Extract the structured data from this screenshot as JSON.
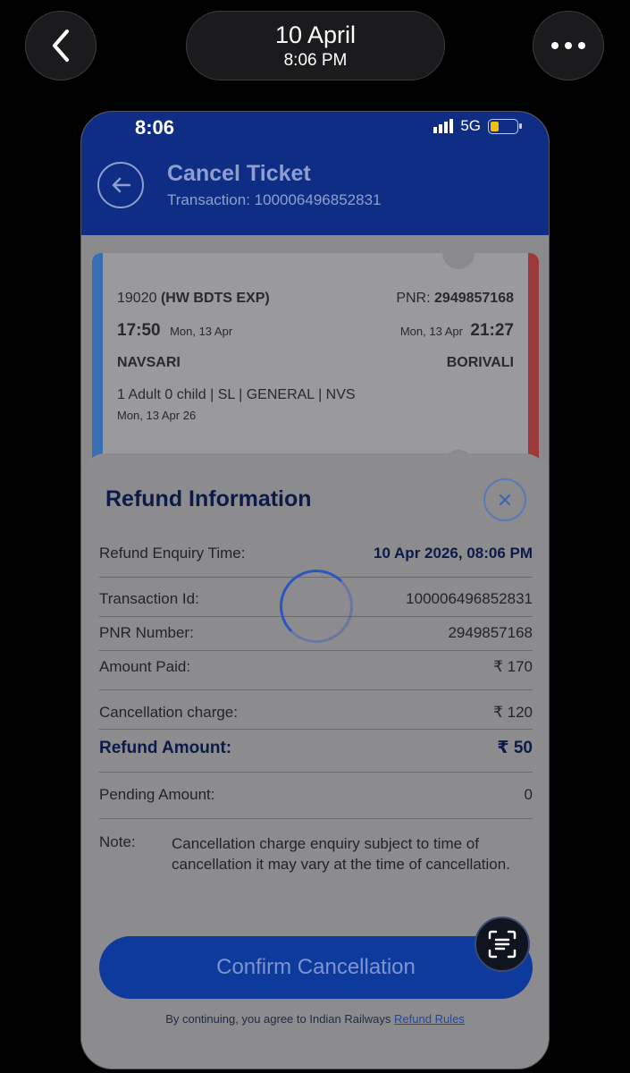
{
  "viewer": {
    "date": "10 April",
    "time": "8:06 PM",
    "back_icon": "chevron-left-icon",
    "more_icon": "ellipsis-icon"
  },
  "status_bar": {
    "time": "8:06",
    "network": "5G"
  },
  "header": {
    "title": "Cancel Ticket",
    "transaction_label": "Transaction:",
    "transaction_value": "100006496852831"
  },
  "ticket": {
    "train_number": "19020",
    "train_name": "(HW BDTS EXP)",
    "pnr_label": "PNR:",
    "pnr_value": "2949857168",
    "depart_time": "17:50",
    "depart_date": "Mon, 13 Apr",
    "arrive_date": "Mon, 13 Apr",
    "arrive_time": "21:27",
    "from_station": "NAVSARI",
    "to_station": "BORIVALI",
    "passengers": "1 Adult 0 child",
    "class": "SL",
    "quota": "GENERAL",
    "boarding": "NVS",
    "journey_date": "Mon, 13 Apr 26"
  },
  "refund": {
    "title": "Refund Information",
    "rows": [
      {
        "label": "Refund Enquiry Time:",
        "value": "10 Apr 2026, 08:06 PM"
      },
      {
        "label": "Transaction Id:",
        "value": "100006496852831"
      },
      {
        "label": "PNR Number:",
        "value": "2949857168"
      },
      {
        "label": "Amount Paid:",
        "value": "₹ 170"
      },
      {
        "label": "Cancellation charge:",
        "value": "₹ 120"
      },
      {
        "label": "Refund Amount:",
        "value": "₹ 50"
      },
      {
        "label": "Pending Amount:",
        "value": "0"
      }
    ],
    "note_label": "Note:",
    "note_text": "Cancellation charge enquiry subject to time of cancellation it may vary at the time of cancellation.",
    "confirm_label": "Confirm Cancellation",
    "terms_prefix": "By continuing, you agree to Indian Railways",
    "terms_link": "Refund Rules"
  },
  "colors": {
    "header_blue": "#0f2d85",
    "button_blue": "#0e3a9d",
    "title_navy": "#0c1a48"
  }
}
